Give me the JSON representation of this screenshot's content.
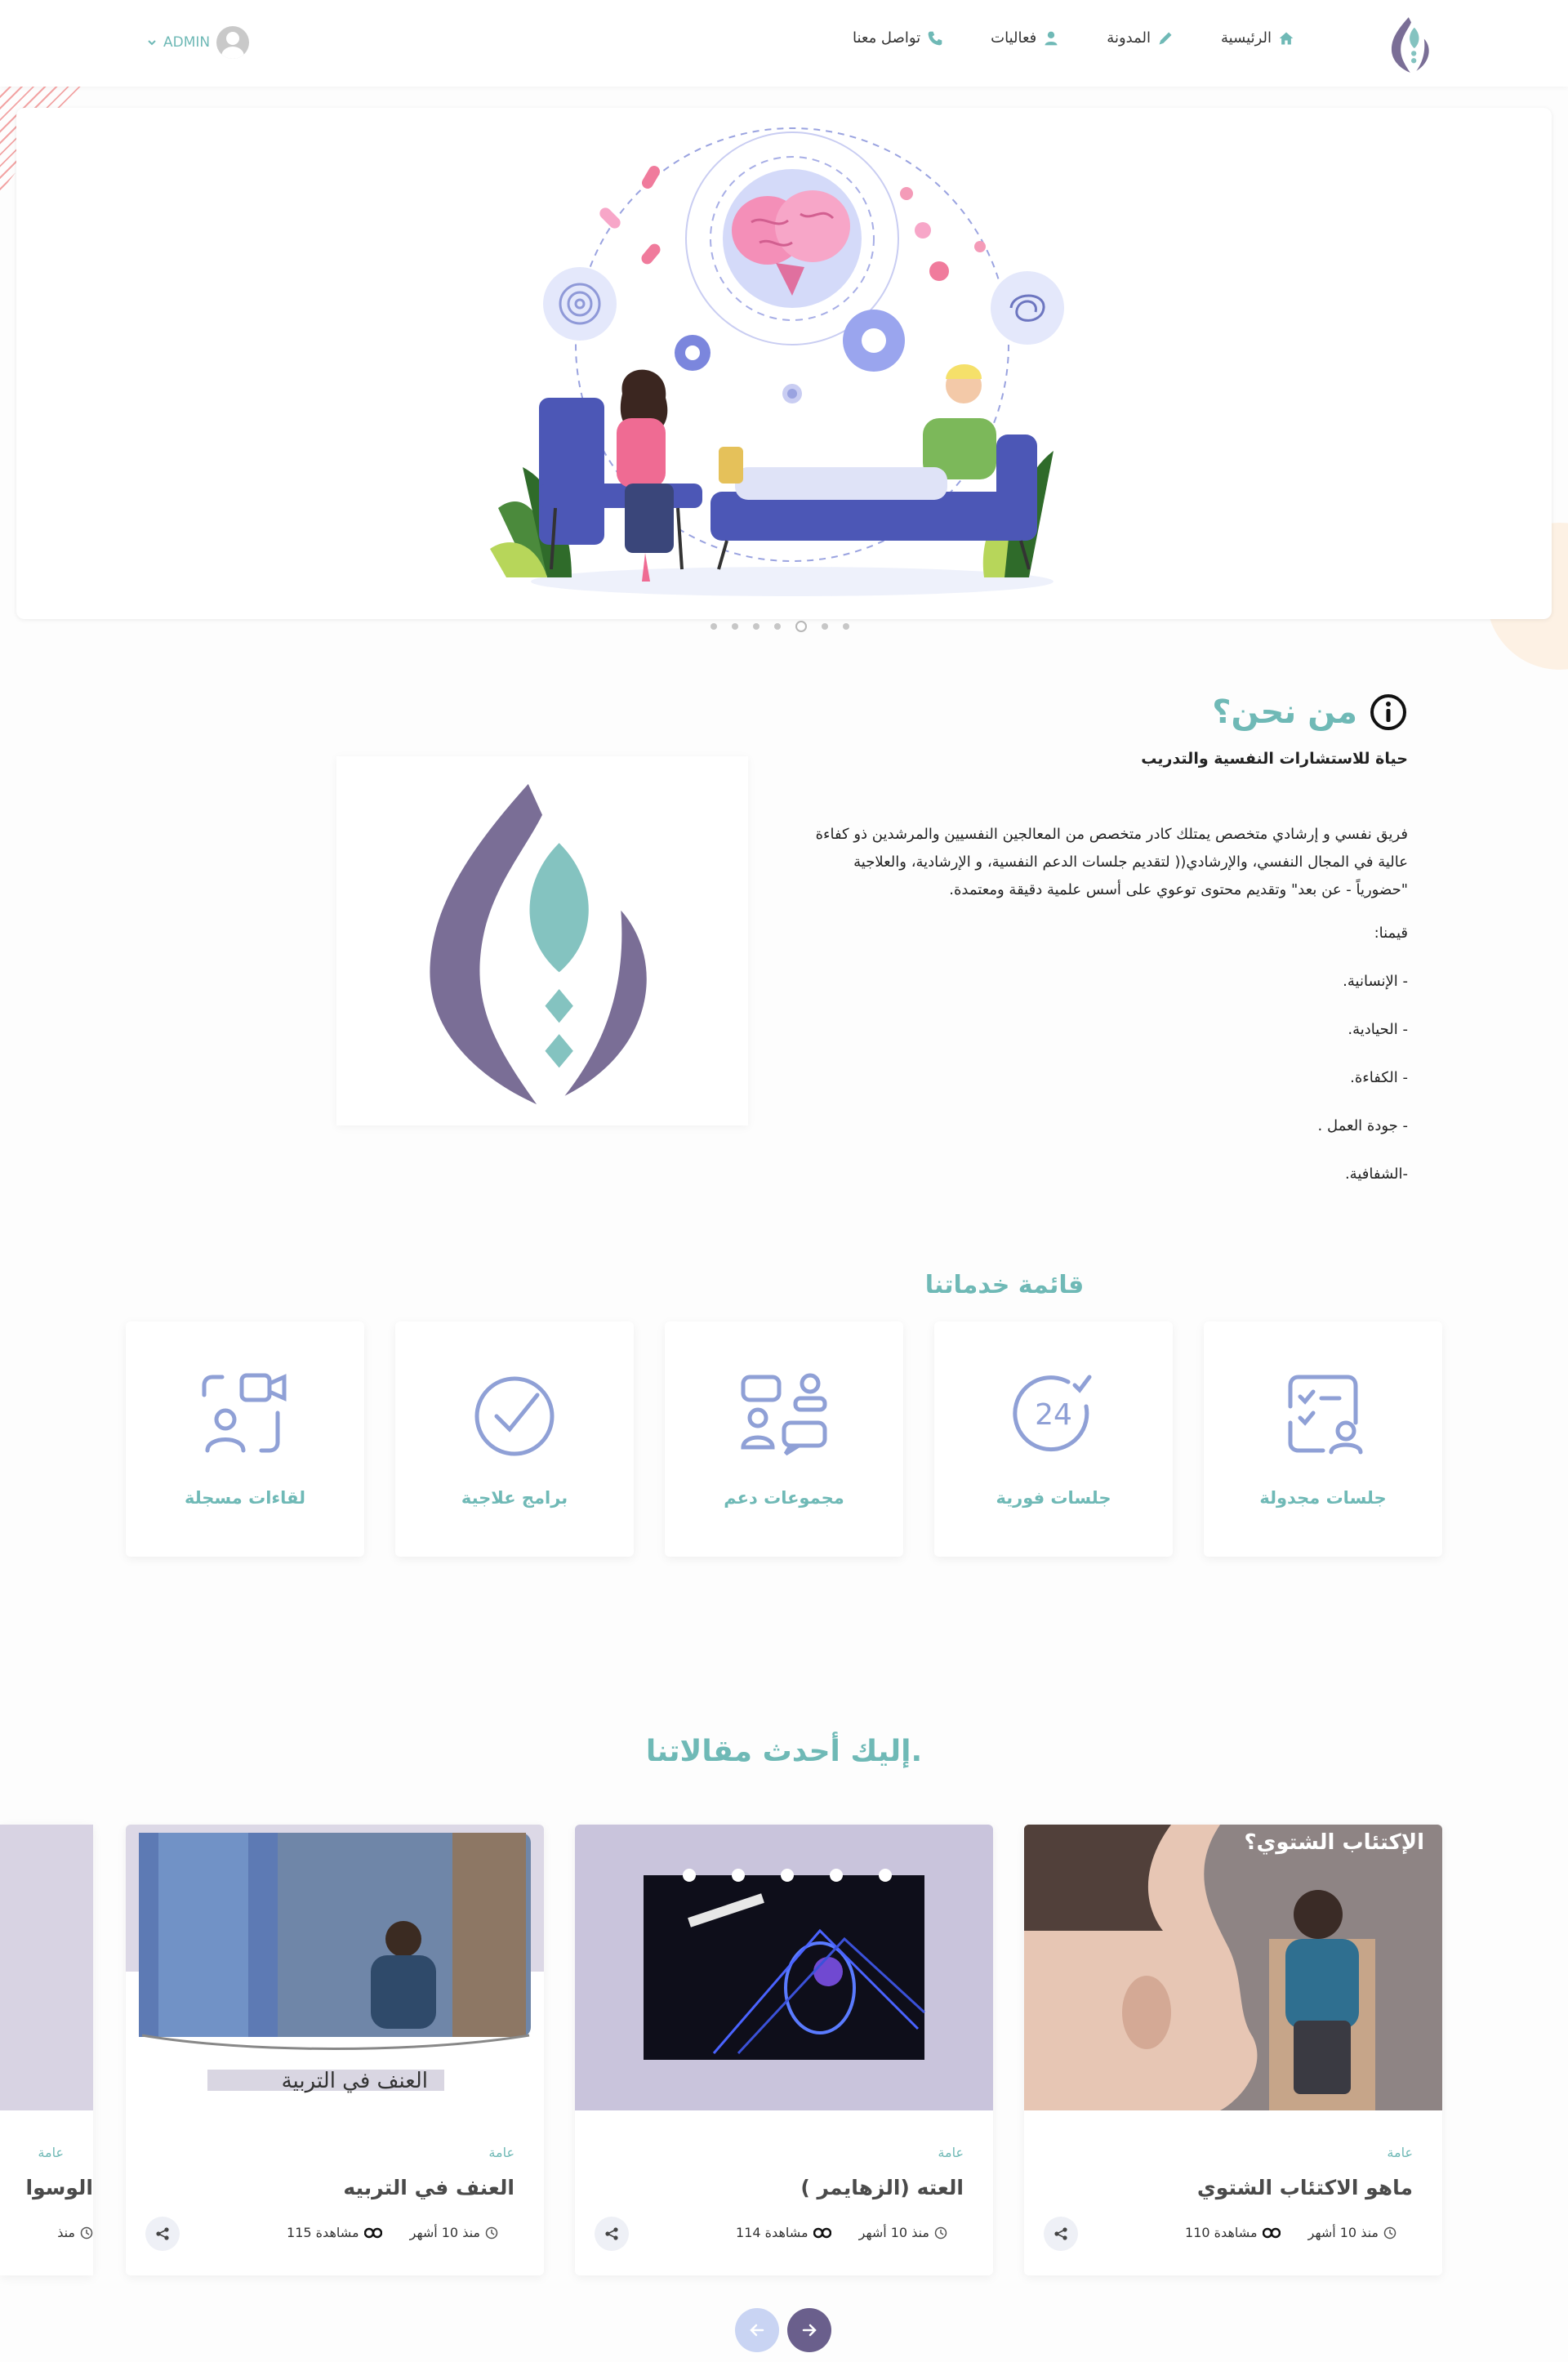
{
  "nav": {
    "items": [
      {
        "label": "الرئيسية",
        "icon": "home-icon"
      },
      {
        "label": "المدونة",
        "icon": "pencil-icon"
      },
      {
        "label": "فعاليات",
        "icon": "user-icon"
      },
      {
        "label": "تواصل معنا",
        "icon": "phone-icon"
      }
    ],
    "admin_label": "ADMIN",
    "admin_icon": "chevron-down-icon"
  },
  "hero": {
    "slide_count": 7,
    "active_slide": 5
  },
  "about": {
    "title": "من نحن؟",
    "subtitle": "حياة للاستشارات النفسية والتدريب",
    "paragraph": "فريق نفسي و إرشادي متخصص يمتلك كادر متخصص من المعالجين النفسيين والمرشدين ذو كفاءة عالية في المجال النفسي، والإرشادي(( لتقديم جلسات الدعم النفسية، و الإرشادية، والعلاجية \"حضورياً - عن بعد\" وتقديم محتوى توعوي على أسس علمية دقيقة ومعتمدة.",
    "values_heading": "قيمنا:",
    "values": [
      "- الإنسانية.",
      "- الحيادية.",
      "- الكفاءة.",
      "- جودة العمل .",
      "-الشفافية."
    ]
  },
  "services": {
    "title": "قائمة خدماتنا",
    "items": [
      {
        "label": "جلسات مجدولة",
        "icon": "scheduled-session-icon"
      },
      {
        "label": "جلسات فورية",
        "icon": "24-hours-icon"
      },
      {
        "label": "مجموعات دعم",
        "icon": "support-group-icon"
      },
      {
        "label": "برامج علاجية",
        "icon": "check-circle-icon"
      },
      {
        "label": "لقاءات مسجلة",
        "icon": "video-call-icon"
      }
    ]
  },
  "articles": {
    "title": "إليك أحدث مقالاتنا.",
    "items": [
      {
        "category": "عامة",
        "title": "ماهو الاكتئاب الشتوي",
        "image_caption": "الإكتئاب الشتوي؟",
        "time": "منذ 10 أشهر",
        "views": "110 مشاهدة"
      },
      {
        "category": "عامة",
        "title": "العته (الزهايمر )",
        "image_caption": "",
        "time": "منذ 10 أشهر",
        "views": "114 مشاهدة"
      },
      {
        "category": "عامة",
        "title": "العنف في التربيه",
        "image_caption": "العنف في التربية",
        "time": "منذ 10 أشهر",
        "views": "115 مشاهدة"
      },
      {
        "category": "عامة",
        "title": "الوسوا",
        "image_caption": "",
        "time": "منذ",
        "views": ""
      }
    ]
  },
  "colors": {
    "accent_teal": "#6fb9b6",
    "brand_purple": "#7a6e96",
    "service_icon": "#8fa0d6"
  }
}
